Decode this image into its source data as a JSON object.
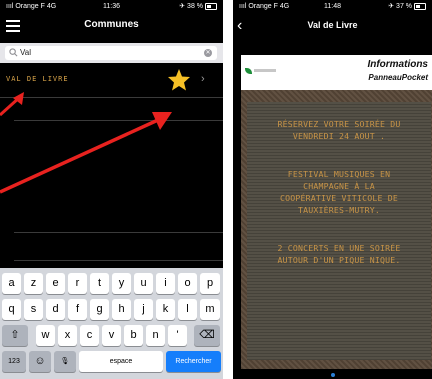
{
  "left_phone": {
    "status": {
      "carrier": "ıııl Orange F 4G",
      "time": "11:36",
      "battery": "✈ 38 %"
    },
    "nav": {
      "title": "Communes"
    },
    "search": {
      "value": "Val",
      "placeholder": ""
    },
    "results": [
      {
        "label": "VAL DE LIVRE",
        "favorite": true
      }
    ],
    "keyboard": {
      "row1": [
        "a",
        "z",
        "e",
        "r",
        "t",
        "y",
        "u",
        "i",
        "o",
        "p"
      ],
      "row2": [
        "q",
        "s",
        "d",
        "f",
        "g",
        "h",
        "j",
        "k",
        "l",
        "m"
      ],
      "row3": [
        "w",
        "x",
        "c",
        "v",
        "b",
        "n",
        "'"
      ],
      "shift_label": "⇧",
      "backspace_label": "⌫",
      "numbers_label": "123",
      "emoji_label": "☺",
      "mic_label": "🎙",
      "space_label": "espace",
      "search_label": "Rechercher"
    },
    "colors": {
      "arrow": "#e8221f",
      "star": "#f6c026"
    }
  },
  "right_phone": {
    "status": {
      "carrier": "ıııl Orange F 4G",
      "time": "11:48",
      "battery": "✈ 37 %"
    },
    "nav": {
      "title": "Val de Livre"
    },
    "card": {
      "heading": "Informations",
      "subheading": "PanneauPocket",
      "logo_text": "VAL DE LIVRE",
      "lines": [
        "RÉSERVEZ VOTRE SOIRÉE DU",
        "VENDREDI 24 AOUT .",
        "",
        "FESTIVAL MUSIQUES EN",
        "CHAMPAGNE À LA",
        "COOPÉRATIVE VITICOLE DE",
        "TAUXIÈRES-MUTRY.",
        "",
        "2 CONCERTS EN UNE SOIRÉE",
        "AUTOUR D'UN PIQUE NIQUE."
      ]
    },
    "colors": {
      "led_text": "#c89447"
    }
  }
}
